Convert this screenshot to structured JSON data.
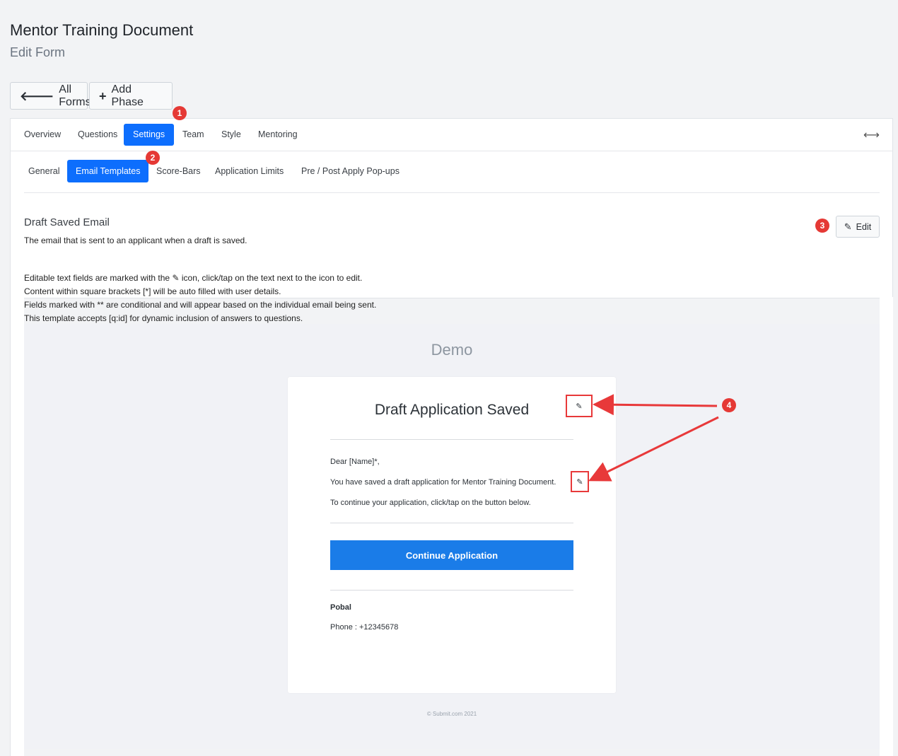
{
  "header": {
    "title": "Mentor Training Document",
    "subtitle": "Edit Form"
  },
  "toolbar": {
    "all_forms_label": "All Forms",
    "add_phase_label": "Add Phase"
  },
  "tabs": [
    "Overview",
    "Questions",
    "Settings",
    "Team",
    "Style",
    "Mentoring"
  ],
  "active_tab": "Settings",
  "subtabs": [
    "General",
    "Email Templates",
    "Score-Bars",
    "Application Limits",
    "Pre / Post Apply Pop-ups"
  ],
  "active_subtab": "Email Templates",
  "section": {
    "title": "Draft Saved Email",
    "description": "The email that is sent to an applicant when a draft is saved.",
    "edit_label": "Edit"
  },
  "info": {
    "line1_prefix": "Editable text fields are marked with the",
    "line1_suffix": "icon, click/tap on the text next to the icon to edit.",
    "line2": "Content within square brackets [*] will be auto filled with user details.",
    "line3": "Fields marked with ** are conditional and will appear based on the individual email being sent.",
    "line4": "This template accepts [q:id] for dynamic inclusion of answers to questions."
  },
  "demo": {
    "title": "Demo",
    "email_heading": "Draft Application Saved",
    "greeting": "Dear [Name]*,",
    "body1": "You have saved a draft application for Mentor Training Document.",
    "body2": "To continue your application, click/tap on the button below.",
    "button_label": "Continue Application",
    "org_name": "Pobal",
    "phone": "Phone : +12345678",
    "footer": "© Submit.com 2021"
  },
  "annotations": [
    "1",
    "2",
    "3",
    "4"
  ],
  "colors": {
    "primary": "#0d6efd",
    "email_button": "#1a7ce8",
    "annotation": "#e53935"
  }
}
